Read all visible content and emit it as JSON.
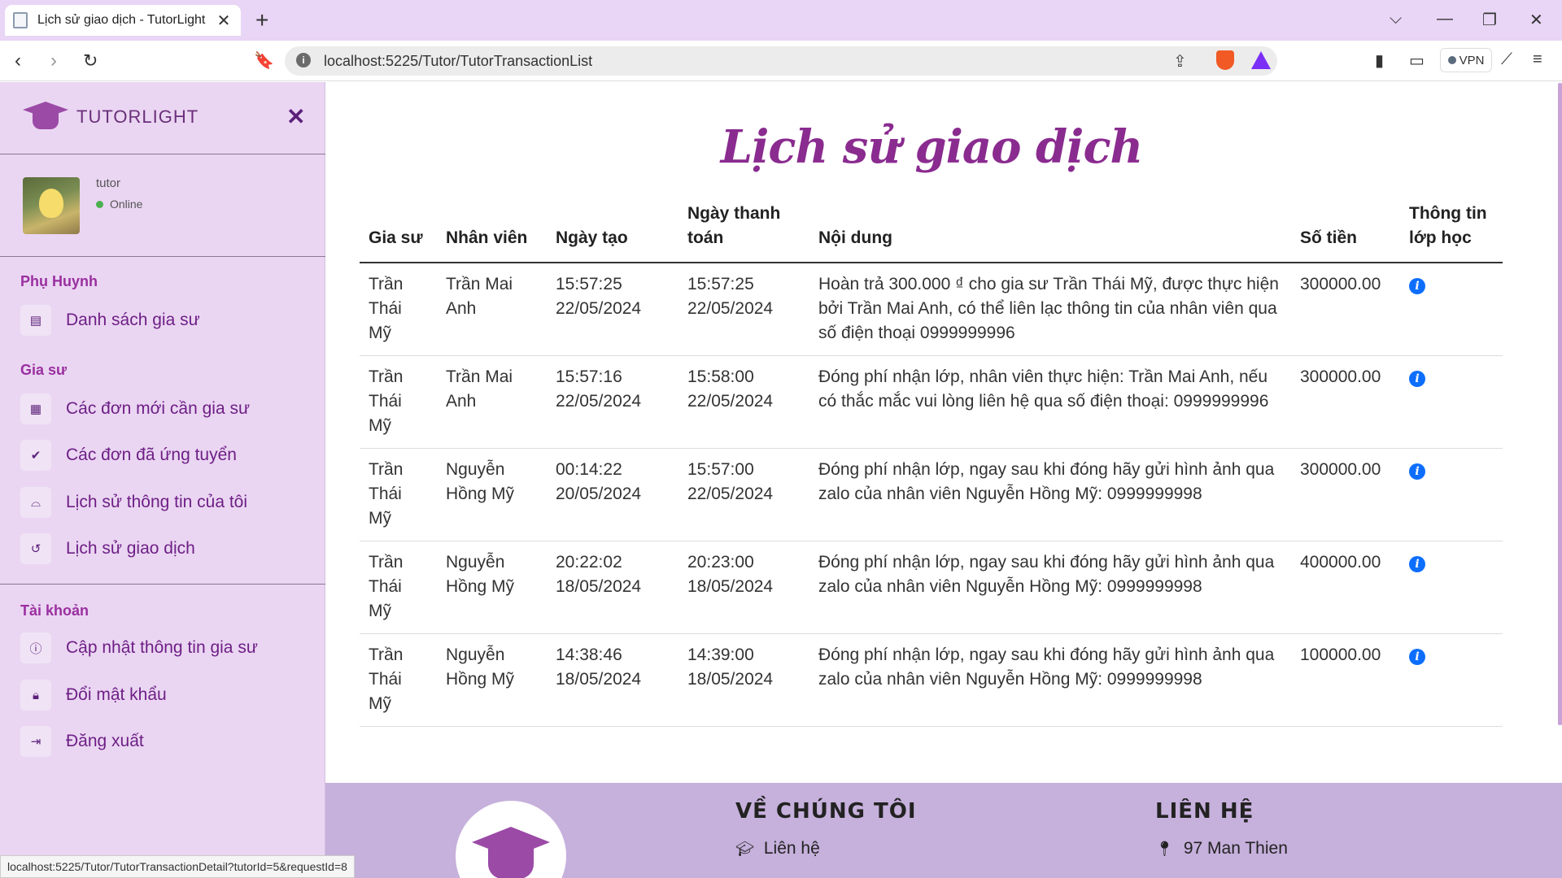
{
  "browser": {
    "tab_title": "Lịch sử giao dịch - TutorLight",
    "url": "localhost:5225/Tutor/TutorTransactionList",
    "vpn_label": "VPN",
    "status_url": "localhost:5225/Tutor/TutorTransactionDetail?tutorId=5&requestId=8"
  },
  "sidebar": {
    "brand": "TUTORLIGHT",
    "user": {
      "name": "tutor",
      "status": "Online"
    },
    "sections": [
      {
        "heading": "Phụ Huynh",
        "items": [
          {
            "label": "Danh sách gia sư",
            "icon": "address-card-icon"
          }
        ]
      },
      {
        "heading": "Gia sư",
        "items": [
          {
            "label": "Các đơn mới cần gia sư",
            "icon": "calendar-icon"
          },
          {
            "label": "Các đơn đã ứng tuyển",
            "icon": "check-circle-icon"
          },
          {
            "label": "Lịch sử thông tin của tôi",
            "icon": "inbox-icon"
          },
          {
            "label": "Lịch sử giao dịch",
            "icon": "history-icon"
          }
        ]
      },
      {
        "heading": "Tài khoản",
        "items": [
          {
            "label": "Cập nhật thông tin gia sư",
            "icon": "info-circle-icon"
          },
          {
            "label": "Đổi mật khẩu",
            "icon": "lock-icon"
          },
          {
            "label": "Đăng xuất",
            "icon": "sign-out-icon"
          }
        ]
      }
    ]
  },
  "main": {
    "title": "Lịch sử giao dịch",
    "columns": [
      "Gia sư",
      "Nhân viên",
      "Ngày tạo",
      "Ngày thanh toán",
      "Nội dung",
      "Số tiền",
      "Thông tin lớp học"
    ],
    "rows": [
      {
        "tutor": "Trần Thái Mỹ",
        "staff": "Trần Mai Anh",
        "created_time": "15:57:25",
        "created_date": "22/05/2024",
        "paid_time": "15:57:25",
        "paid_date": "22/05/2024",
        "content": "Hoàn trả 300.000 ₫ cho gia sư Trần Thái Mỹ, được thực hiện bởi Trần Mai Anh, có thể liên lạc thông tin của nhân viên qua số điện thoại 0999999996",
        "amount": "300000.00"
      },
      {
        "tutor": "Trần Thái Mỹ",
        "staff": "Trần Mai Anh",
        "created_time": "15:57:16",
        "created_date": "22/05/2024",
        "paid_time": "15:58:00",
        "paid_date": "22/05/2024",
        "content": "Đóng phí nhận lớp, nhân viên thực hiện: Trần Mai Anh, nếu có thắc mắc vui lòng liên hệ qua số điện thoại: 0999999996",
        "amount": "300000.00"
      },
      {
        "tutor": "Trần Thái Mỹ",
        "staff": "Nguyễn Hồng Mỹ",
        "created_time": "00:14:22",
        "created_date": "20/05/2024",
        "paid_time": "15:57:00",
        "paid_date": "22/05/2024",
        "content": "Đóng phí nhận lớp, ngay sau khi đóng hãy gửi hình ảnh qua zalo của nhân viên Nguyễn Hồng Mỹ: 0999999998",
        "amount": "300000.00"
      },
      {
        "tutor": "Trần Thái Mỹ",
        "staff": "Nguyễn Hồng Mỹ",
        "created_time": "20:22:02",
        "created_date": "18/05/2024",
        "paid_time": "20:23:00",
        "paid_date": "18/05/2024",
        "content": "Đóng phí nhận lớp, ngay sau khi đóng hãy gửi hình ảnh qua zalo của nhân viên Nguyễn Hồng Mỹ: 0999999998",
        "amount": "400000.00"
      },
      {
        "tutor": "Trần Thái Mỹ",
        "staff": "Nguyễn Hồng Mỹ",
        "created_time": "14:38:46",
        "created_date": "18/05/2024",
        "paid_time": "14:39:00",
        "paid_date": "18/05/2024",
        "content": "Đóng phí nhận lớp, ngay sau khi đóng hãy gửi hình ảnh qua zalo của nhân viên Nguyễn Hồng Mỹ: 0999999998",
        "amount": "100000.00"
      }
    ]
  },
  "footer": {
    "about_heading": "VỀ CHÚNG TÔI",
    "about_link": "Liên hệ",
    "contact_heading": "LIÊN HỆ",
    "address": "97 Man Thien"
  },
  "colors": {
    "accent": "#8a2b8f",
    "sidebar_bg": "#ead6f2",
    "footer_bg": "#c6b0dc",
    "info_icon": "#0d6efd"
  }
}
